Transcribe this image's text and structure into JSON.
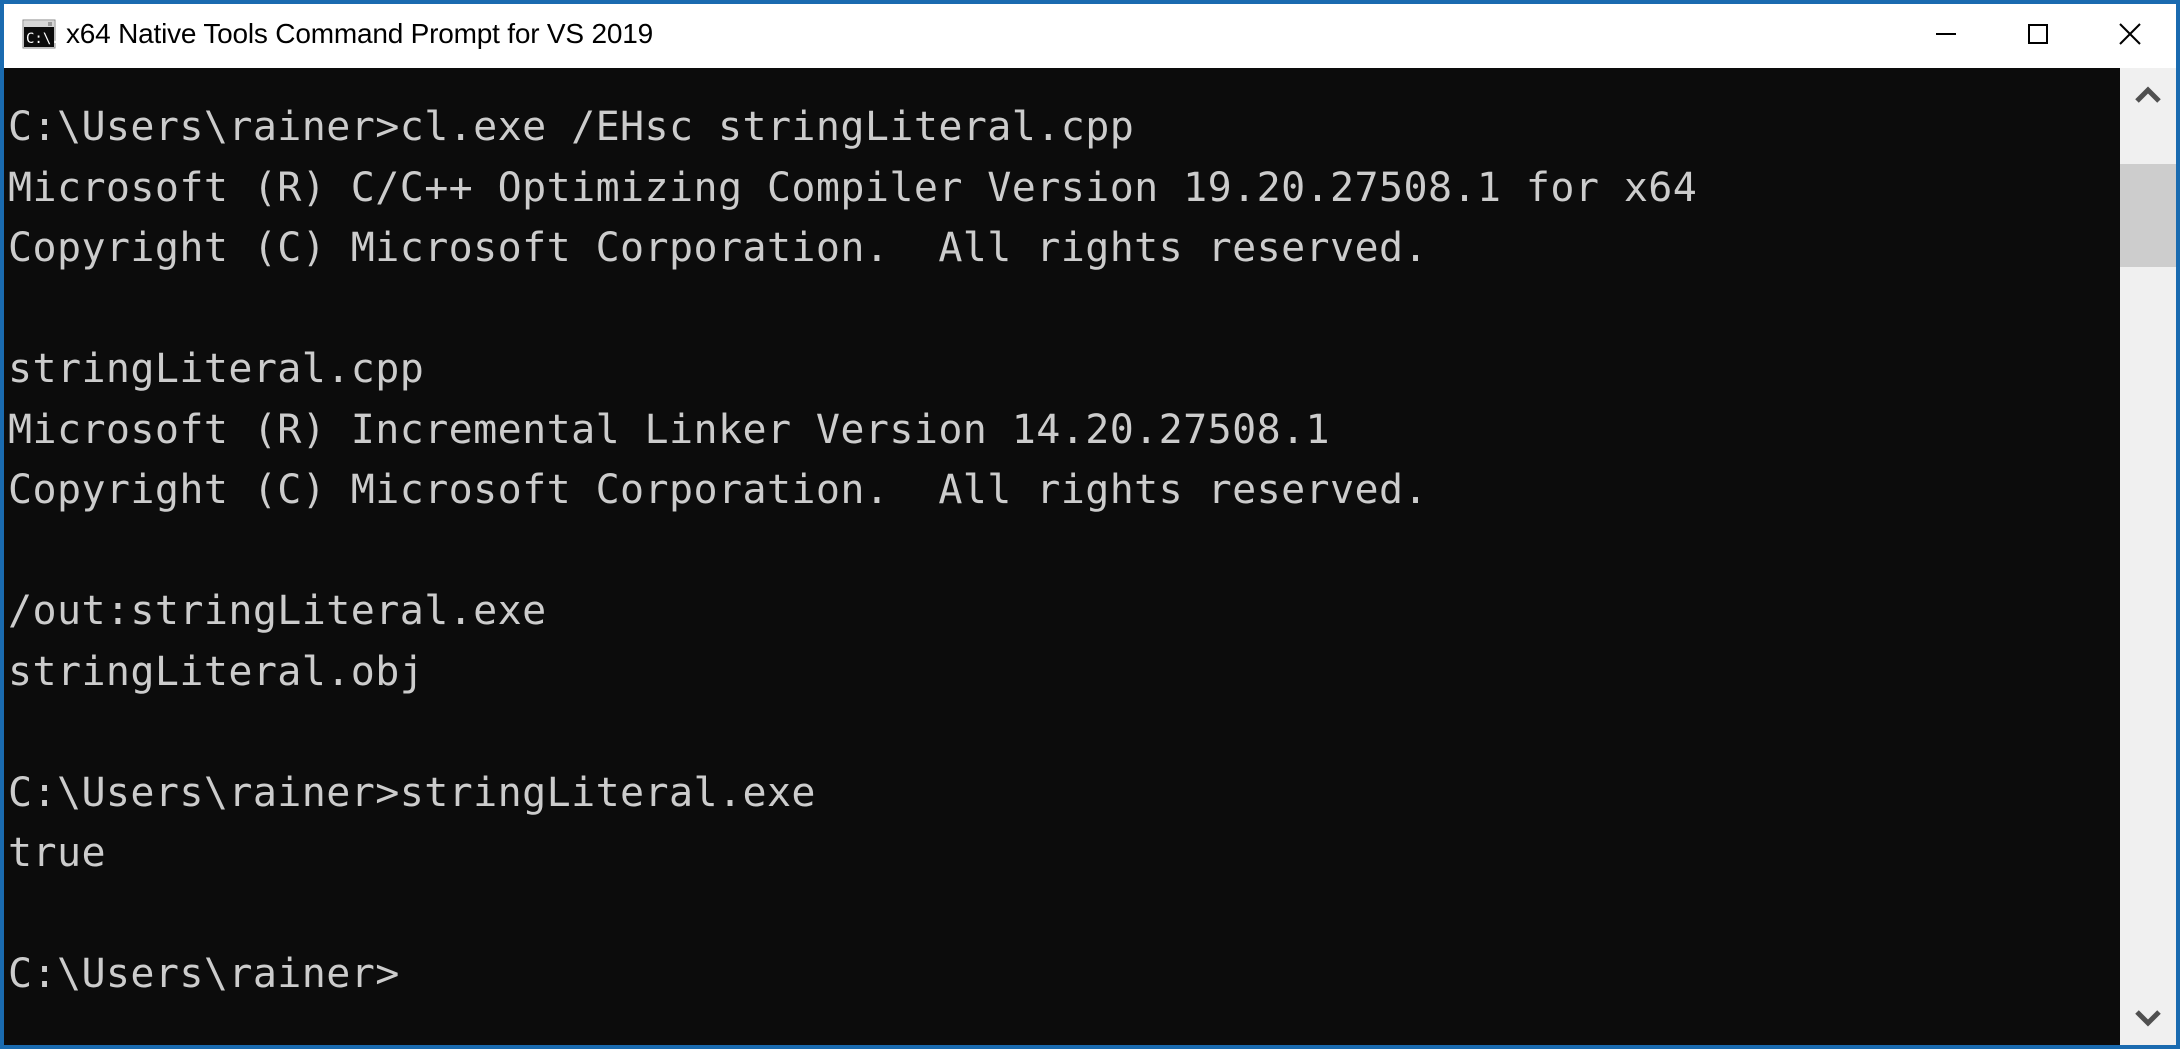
{
  "window": {
    "title": "x64 Native Tools Command Prompt for VS 2019",
    "icon": "cmd-console-icon",
    "border_color": "#1a6bb0",
    "titlebar_background": "#ffffff",
    "title_color": "#000000"
  },
  "controls": {
    "minimize": {
      "name": "minimize-button",
      "glyph": "—",
      "label": "Minimize"
    },
    "maximize": {
      "name": "maximize-button",
      "glyph": "□",
      "label": "Maximize"
    },
    "close": {
      "name": "close-button",
      "glyph": "✕",
      "label": "Close"
    }
  },
  "console": {
    "background": "#0c0c0c",
    "foreground": "#cccccc",
    "prompt": "C:\\Users\\rainer>",
    "lines": [
      "C:\\Users\\rainer>cl.exe /EHsc stringLiteral.cpp",
      "Microsoft (R) C/C++ Optimizing Compiler Version 19.20.27508.1 for x64",
      "Copyright (C) Microsoft Corporation.  All rights reserved.",
      "",
      "stringLiteral.cpp",
      "Microsoft (R) Incremental Linker Version 14.20.27508.1",
      "Copyright (C) Microsoft Corporation.  All rights reserved.",
      "",
      "/out:stringLiteral.exe",
      "stringLiteral.obj",
      "",
      "C:\\Users\\rainer>stringLiteral.exe",
      "true",
      "",
      "C:\\Users\\rainer>"
    ]
  },
  "scrollbar": {
    "up_button": "scroll-up-button",
    "down_button": "scroll-down-button",
    "thumb": "scrollbar-thumb",
    "track_color": "#f0f0f0",
    "thumb_color": "#cdcdcd"
  }
}
